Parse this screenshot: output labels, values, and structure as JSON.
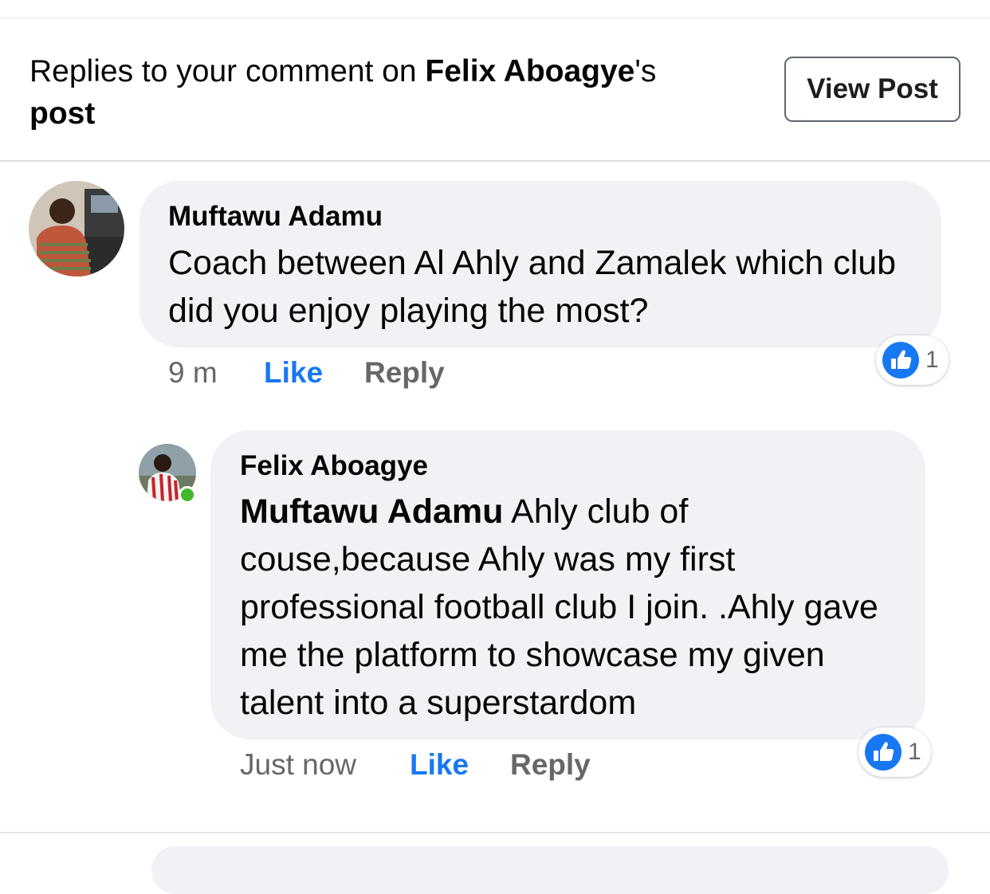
{
  "header": {
    "prefix": "Replies to your comment on ",
    "post_owner": "Felix Aboagye",
    "suffix": "'s",
    "post_word": "post",
    "view_post_label": "View Post"
  },
  "comments": [
    {
      "author": "Muftawu Adamu",
      "text": "Coach between Al Ahly and Zamalek which club did you enjoy playing the most?",
      "time": "9 m",
      "like_label": "Like",
      "reply_label": "Reply",
      "reaction_count": "1",
      "reaction_icon": "thumbs-up-icon"
    },
    {
      "author": "Felix Aboagye",
      "mention": "Muftawu Adamu",
      "text": " Ahly club of couse,because Ahly was my first professional football club I join. .Ahly gave me the platform to showcase my given talent into a superstardom",
      "time": "Just now",
      "like_label": "Like",
      "reply_label": "Reply",
      "reaction_count": "1",
      "reaction_icon": "thumbs-up-icon",
      "online": true
    }
  ],
  "colors": {
    "accent": "#1877f2",
    "bubble": "#f0f2f5",
    "muted": "#65676b",
    "online": "#42b72a"
  }
}
